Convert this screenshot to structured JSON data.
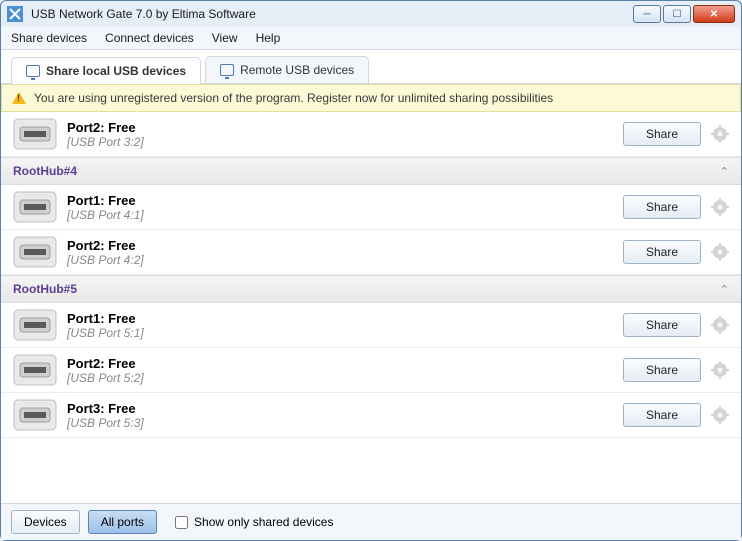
{
  "window": {
    "title": "USB Network Gate 7.0 by Eltima Software"
  },
  "menu": {
    "share": "Share devices",
    "connect": "Connect devices",
    "view": "View",
    "help": "Help"
  },
  "tabs": {
    "local": "Share local USB devices",
    "remote": "Remote USB devices"
  },
  "notification": "You are using unregistered version of the program. Register now for unlimited sharing possibilities",
  "share_label": "Share",
  "hubs": [
    {
      "name": "RootHub#4"
    },
    {
      "name": "RootHub#5"
    }
  ],
  "ports": {
    "orphan": {
      "title": "Port2: Free",
      "sub": "[USB Port 3:2]"
    },
    "h4p1": {
      "title": "Port1: Free",
      "sub": "[USB Port 4:1]"
    },
    "h4p2": {
      "title": "Port2: Free",
      "sub": "[USB Port 4:2]"
    },
    "h5p1": {
      "title": "Port1: Free",
      "sub": "[USB Port 5:1]"
    },
    "h5p2": {
      "title": "Port2: Free",
      "sub": "[USB Port 5:2]"
    },
    "h5p3": {
      "title": "Port3: Free",
      "sub": "[USB Port 5:3]"
    }
  },
  "footer": {
    "devices": "Devices",
    "allports": "All ports",
    "showonly": "Show only shared devices"
  }
}
